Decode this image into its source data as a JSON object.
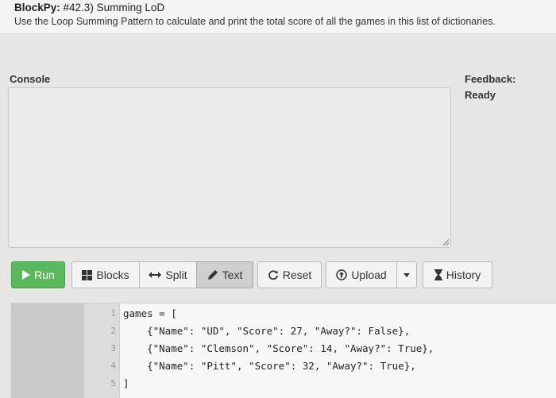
{
  "header": {
    "app_name": "BlockPy:",
    "assignment": " #42.3) Summing LoD",
    "instructions": "Use the Loop Summing Pattern to calculate and print the total score of all the games in this list of dictionaries."
  },
  "console": {
    "label": "Console"
  },
  "feedback": {
    "label": "Feedback:",
    "status": "Ready"
  },
  "toolbar": {
    "run": {
      "label": "Run",
      "icon": "play-icon"
    },
    "blocks": {
      "label": "Blocks",
      "icon": "blocks-icon"
    },
    "split": {
      "label": "Split",
      "icon": "split-arrows-icon"
    },
    "text": {
      "label": "Text",
      "icon": "pencil-icon"
    },
    "reset": {
      "label": "Reset",
      "icon": "refresh-icon"
    },
    "upload": {
      "label": "Upload",
      "icon": "upload-icon"
    },
    "upload_menu": {
      "icon": "caret-down-icon"
    },
    "history": {
      "label": "History",
      "icon": "hourglass-icon"
    },
    "colors": {
      "run_bg": "#5cb85c",
      "text_active_bg": "#cfcfcd"
    }
  },
  "editor": {
    "line_numbers": [
      "1",
      "2",
      "3",
      "4",
      "5"
    ],
    "lines": [
      "games = [",
      "    {\"Name\": \"UD\", \"Score\": 27, \"Away?\": False},",
      "    {\"Name\": \"Clemson\", \"Score\": 14, \"Away?\": True},",
      "    {\"Name\": \"Pitt\", \"Score\": 32, \"Away?\": True},",
      "]"
    ]
  }
}
